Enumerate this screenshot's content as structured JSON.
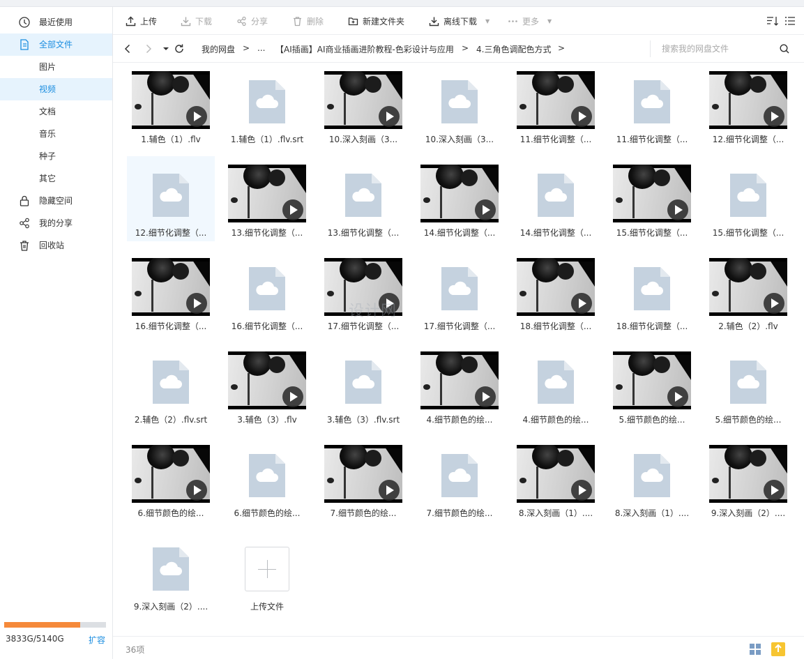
{
  "sidebar": {
    "items": [
      {
        "label": "最近使用",
        "icon": "clock-icon"
      },
      {
        "label": "全部文件",
        "icon": "file-icon"
      },
      {
        "label": "图片"
      },
      {
        "label": "视频"
      },
      {
        "label": "文档"
      },
      {
        "label": "音乐"
      },
      {
        "label": "种子"
      },
      {
        "label": "其它"
      },
      {
        "label": "隐藏空间",
        "icon": "lock-icon"
      },
      {
        "label": "我的分享",
        "icon": "share-icon"
      },
      {
        "label": "回收站",
        "icon": "trash-icon"
      }
    ],
    "quota_text": "3833G/5140G",
    "quota_fraction": 0.7457,
    "expand_label": "扩容"
  },
  "toolbar": {
    "upload": "上传",
    "download": "下载",
    "share": "分享",
    "delete": "删除",
    "new_folder": "新建文件夹",
    "offline_download": "离线下载",
    "more": "更多"
  },
  "breadcrumb": {
    "items": [
      "我的网盘",
      "...",
      "【AI插画】AI商业插画进阶教程-色彩设计与应用",
      "4.三角色调配色方式"
    ],
    "separator": ">"
  },
  "search": {
    "placeholder": "搜索我的网盘文件"
  },
  "files": [
    {
      "name": "1.辅色（1）.flv",
      "type": "video"
    },
    {
      "name": "1.辅色（1）.flv.srt",
      "type": "doc"
    },
    {
      "name": "10.深入刻画（3...",
      "type": "video"
    },
    {
      "name": "10.深入刻画（3...",
      "type": "doc"
    },
    {
      "name": "11.细节化调整（...",
      "type": "video"
    },
    {
      "name": "11.细节化调整（...",
      "type": "doc"
    },
    {
      "name": "12.细节化调整（...",
      "type": "video"
    },
    {
      "name": "12.细节化调整（...",
      "type": "doc"
    },
    {
      "name": "13.细节化调整（...",
      "type": "video"
    },
    {
      "name": "13.细节化调整（...",
      "type": "doc"
    },
    {
      "name": "14.细节化调整（...",
      "type": "video"
    },
    {
      "name": "14.细节化调整（...",
      "type": "doc"
    },
    {
      "name": "15.细节化调整（...",
      "type": "video"
    },
    {
      "name": "15.细节化调整（...",
      "type": "doc"
    },
    {
      "name": "16.细节化调整（...",
      "type": "video"
    },
    {
      "name": "16.细节化调整（...",
      "type": "doc"
    },
    {
      "name": "17.细节化调整（...",
      "type": "video"
    },
    {
      "name": "17.细节化调整（...",
      "type": "doc"
    },
    {
      "name": "18.细节化调整（...",
      "type": "video"
    },
    {
      "name": "18.细节化调整（...",
      "type": "doc"
    },
    {
      "name": "2.辅色（2）.flv",
      "type": "video"
    },
    {
      "name": "2.辅色（2）.flv.srt",
      "type": "doc"
    },
    {
      "name": "3.辅色（3）.flv",
      "type": "video"
    },
    {
      "name": "3.辅色（3）.flv.srt",
      "type": "doc"
    },
    {
      "name": "4.细节颜色的绘...",
      "type": "video"
    },
    {
      "name": "4.细节颜色的绘...",
      "type": "doc"
    },
    {
      "name": "5.细节颜色的绘...",
      "type": "video"
    },
    {
      "name": "5.细节颜色的绘...",
      "type": "doc"
    },
    {
      "name": "6.细节颜色的绘...",
      "type": "video"
    },
    {
      "name": "6.细节颜色的绘...",
      "type": "doc"
    },
    {
      "name": "7.细节颜色的绘...",
      "type": "video"
    },
    {
      "name": "7.细节颜色的绘...",
      "type": "doc"
    },
    {
      "name": "8.深入刻画（1）....",
      "type": "video"
    },
    {
      "name": "8.深入刻画（1）....",
      "type": "doc"
    },
    {
      "name": "9.深入刻画（2）....",
      "type": "video"
    },
    {
      "name": "9.深入刻画（2）....",
      "type": "doc"
    }
  ],
  "upload_tile_label": "上传文件",
  "status": {
    "count": "36项"
  },
  "watermark": "设计网",
  "colors": {
    "accent": "#1c8ee0",
    "quota": "#f5893a",
    "doc_icon": "#c5d2df"
  }
}
